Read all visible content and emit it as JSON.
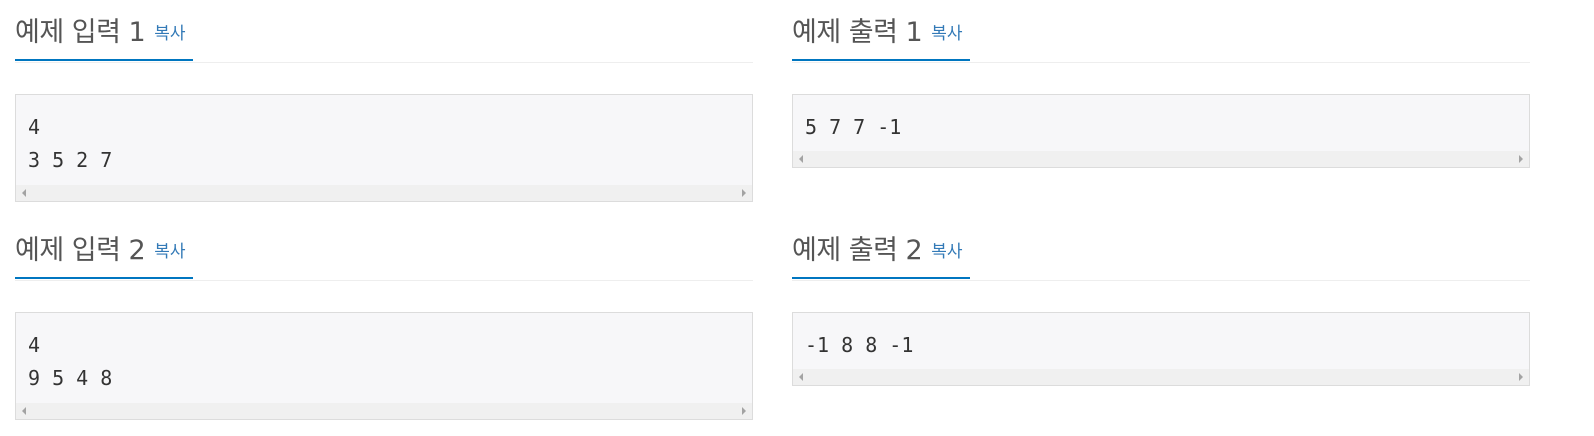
{
  "samples": [
    {
      "title": "예제 입력 1",
      "copy_label": "복사",
      "content": "4\n3 5 2 7"
    },
    {
      "title": "예제 출력 1",
      "copy_label": "복사",
      "content": "5 7 7 -1"
    },
    {
      "title": "예제 입력 2",
      "copy_label": "복사",
      "content": "4\n9 5 4 8"
    },
    {
      "title": "예제 출력 2",
      "copy_label": "복사",
      "content": "-1 8 8 -1"
    }
  ],
  "colors": {
    "accent": "#0076c0",
    "link": "#337ab7",
    "code_background": "#f7f7f9",
    "heading_text": "#555555"
  }
}
